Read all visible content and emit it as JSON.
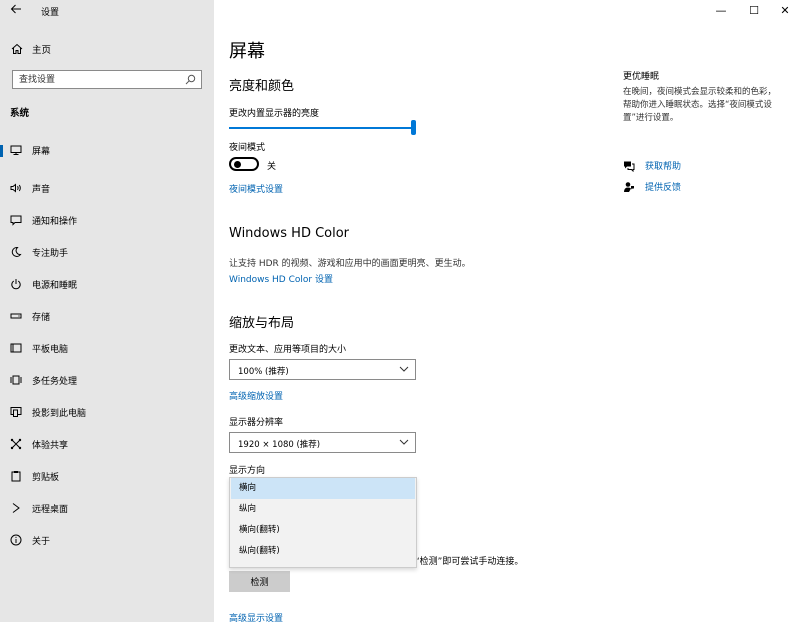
{
  "window": {
    "title": "设置",
    "back_icon": "back-arrow-icon",
    "minimize": "—",
    "maximize": "☐",
    "close": "✕"
  },
  "sidebar": {
    "home_label": "主页",
    "search_placeholder": "查找设置",
    "section_heading": "系统",
    "items": [
      {
        "label": "屏幕",
        "icon": "monitor-icon",
        "active": true
      },
      {
        "label": "声音",
        "icon": "speaker-icon"
      },
      {
        "label": "通知和操作",
        "icon": "notification-icon"
      },
      {
        "label": "专注助手",
        "icon": "moon-icon"
      },
      {
        "label": "电源和睡眠",
        "icon": "power-icon"
      },
      {
        "label": "存储",
        "icon": "storage-icon"
      },
      {
        "label": "平板电脑",
        "icon": "tablet-icon"
      },
      {
        "label": "多任务处理",
        "icon": "multitask-icon"
      },
      {
        "label": "投影到此电脑",
        "icon": "project-icon"
      },
      {
        "label": "体验共享",
        "icon": "share-icon"
      },
      {
        "label": "剪贴板",
        "icon": "clipboard-icon"
      },
      {
        "label": "远程桌面",
        "icon": "remote-desktop-icon"
      },
      {
        "label": "关于",
        "icon": "info-icon"
      }
    ]
  },
  "main": {
    "page_title": "屏幕",
    "brightness_section": "亮度和颜色",
    "brightness_label": "更改内置显示器的亮度",
    "brightness_level_percent": 100,
    "night_mode_label": "夜间模式",
    "night_mode_state": "关",
    "night_mode_link": "夜间模式设置",
    "hdr_section": "Windows HD Color",
    "hdr_desc": "让支持 HDR 的视频、游戏和应用中的画面更明亮、更生动。",
    "hdr_link": "Windows HD Color 设置",
    "scale_section": "缩放与布局",
    "scale_label": "更改文本、应用等项目的大小",
    "scale_value": "100% (推荐)",
    "advanced_scale_link": "高级缩放设置",
    "resolution_label": "显示器分辨率",
    "resolution_value": "1920 × 1080 (推荐)",
    "orientation_label": "显示方向",
    "orientation_options": [
      "横向",
      "纵向",
      "横向(翻转)",
      "纵向(翻转)"
    ],
    "orientation_selected": "横向",
    "partial_text": "“检测”即可尝试手动连接。",
    "detect_button": "检测",
    "advanced_display_link": "高级显示设置"
  },
  "right_panel": {
    "title": "更优睡眠",
    "desc": "在晚间，夜间模式会显示较柔和的色彩，帮助你进入睡眠状态。选择“夜间模式设置”进行设置。",
    "help_link": "获取帮助",
    "feedback_link": "提供反馈"
  },
  "colors": {
    "accent": "#0078d7",
    "link": "#0063b1",
    "sidebar_bg": "#e6e6e6",
    "dropdown_selected": "#cce4f7"
  }
}
